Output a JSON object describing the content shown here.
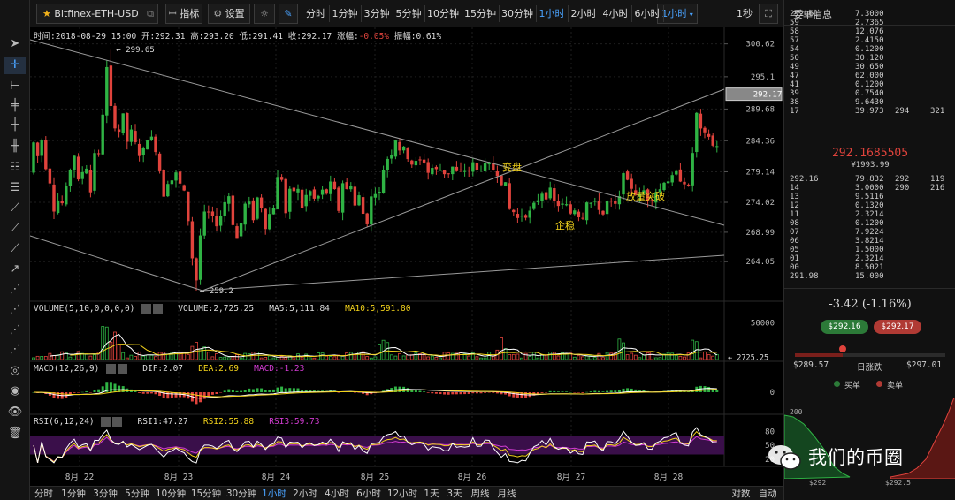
{
  "toolbar": {
    "symbol": "Bitfinex-ETH-USD",
    "indicator_label": "指标",
    "settings_label": "设置",
    "timeframes": [
      "分时",
      "1分钟",
      "3分钟",
      "5分钟",
      "10分钟",
      "15分钟",
      "30分钟",
      "1小时",
      "2小时",
      "4小时",
      "6小时"
    ],
    "active_timeframe": "1小时",
    "dropdown_label": "1小时",
    "refresh_label": "1秒"
  },
  "header_info": "时间:2018-08-29 15:00  开:292.31  高:293.20  低:291.41  收:292.17  涨幅:-0.05%  振幅:0.61%",
  "header_segments": [
    {
      "text": "时间:2018-08-29 15:00  开:292.31  高:293.20  低:291.41  收:292.17  涨幅:",
      "color": "#dddddd"
    },
    {
      "text": "-0.05%",
      "color": "#e0433c"
    },
    {
      "text": "  振幅:0.61%",
      "color": "#dddddd"
    }
  ],
  "price_axis": [
    "300.62",
    "295.1",
    "289.68",
    "284.36",
    "279.14",
    "274.02",
    "268.99",
    "264.05"
  ],
  "current_price_tag": "292.17",
  "annotations": {
    "high_label": "← 299.65",
    "low_label": "← 259.2",
    "change_trend": "变盘",
    "stabilize": "企稳",
    "breakout": "放量突破"
  },
  "volume_panel": {
    "title": "VOLUME(5,10,0,0,0,0)",
    "value": "VOLUME:2,725.25",
    "ma5": "MA5:5,111.84",
    "ma10": "MA10:5,591.80",
    "axis_top": "50000",
    "axis_tag": "← 2725.25"
  },
  "macd_panel": {
    "title": "MACD(12,26,9)",
    "dif": "DIF:2.07",
    "dea": "DEA:2.69",
    "macd": "MACD:-1.23",
    "axis_zero": "0"
  },
  "rsi_panel": {
    "title": "RSI(6,12,24)",
    "rsi1": "RSI1:47.27",
    "rsi2": "RSI2:55.88",
    "rsi3": "RSI3:59.73",
    "axis": [
      "80",
      "50",
      "20"
    ]
  },
  "date_axis": [
    "8月 22",
    "8月 23",
    "8月 24",
    "8月 25",
    "8月 26",
    "8月 27",
    "8月 28"
  ],
  "bottom_bar": {
    "periods": [
      "分时",
      "1分钟",
      "3分钟",
      "5分钟",
      "10分钟",
      "15分钟",
      "30分钟",
      "1小时",
      "2小时",
      "4小时",
      "6小时",
      "12小时",
      "1天",
      "3天",
      "周线",
      "月线"
    ],
    "active": "1小时",
    "right_buttons": [
      "对数",
      "自动"
    ]
  },
  "order_book": {
    "title": "委单信息",
    "asks": [
      {
        "price": "292.61",
        "amount": "7.3000",
        "cum": "",
        "total": ""
      },
      {
        "price": "59",
        "amount": "2.7365",
        "cum": "",
        "total": ""
      },
      {
        "price": "58",
        "amount": "12.076",
        "cum": "",
        "total": ""
      },
      {
        "price": "57",
        "amount": "2.4150",
        "cum": "",
        "total": ""
      },
      {
        "price": "54",
        "amount": "0.1200",
        "cum": "",
        "total": ""
      },
      {
        "price": "50",
        "amount": "30.120",
        "cum": "",
        "total": ""
      },
      {
        "price": "49",
        "amount": "30.650",
        "cum": "",
        "total": ""
      },
      {
        "price": "47",
        "amount": "62.000",
        "cum": "",
        "total": ""
      },
      {
        "price": "41",
        "amount": "0.1200",
        "cum": "",
        "total": ""
      },
      {
        "price": "39",
        "amount": "0.7540",
        "cum": "",
        "total": ""
      },
      {
        "price": "38",
        "amount": "9.6430",
        "cum": "",
        "total": ""
      },
      {
        "price": "17",
        "amount": "39.973",
        "cum": "294",
        "total": "321"
      }
    ],
    "mid_price": "292.1685505",
    "mid_price_sub": "¥1993.99",
    "bids": [
      {
        "price": "292.16",
        "amount": "79.832",
        "cum": "292",
        "total": "119"
      },
      {
        "price": "14",
        "amount": "3.0000",
        "cum": "290",
        "total": "216"
      },
      {
        "price": "13",
        "amount": "9.5116",
        "cum": "",
        "total": ""
      },
      {
        "price": "12",
        "amount": "0.1320",
        "cum": "",
        "total": ""
      },
      {
        "price": "11",
        "amount": "2.3214",
        "cum": "",
        "total": ""
      },
      {
        "price": "08",
        "amount": "0.1200",
        "cum": "",
        "total": ""
      },
      {
        "price": "07",
        "amount": "7.9224",
        "cum": "",
        "total": ""
      },
      {
        "price": "06",
        "amount": "3.8214",
        "cum": "",
        "total": ""
      },
      {
        "price": "05",
        "amount": "1.5000",
        "cum": "",
        "total": ""
      },
      {
        "price": "01",
        "amount": "2.3214",
        "cum": "",
        "total": ""
      },
      {
        "price": "00",
        "amount": "8.5021",
        "cum": "",
        "total": ""
      },
      {
        "price": "291.98",
        "amount": "15.000",
        "cum": "",
        "total": ""
      }
    ],
    "change": "-3.42 (-1.16%)",
    "bid_pill": "$292.16",
    "ask_pill": "$292.17",
    "range_low": "$289.57",
    "range_label": "日涨跌",
    "range_high": "$297.01",
    "range_position": 0.32,
    "legend_buy": "买单",
    "legend_sell": "卖单",
    "depth_axis_top": "200",
    "depth_x": [
      "$292",
      "$292.5"
    ]
  },
  "watermark": "我们的币圈",
  "colors": {
    "up": "#2fb344",
    "down": "#e0433c",
    "accent": "#4aa3ff",
    "yellow": "#f2d21b",
    "magenta": "#d23cd2"
  }
}
